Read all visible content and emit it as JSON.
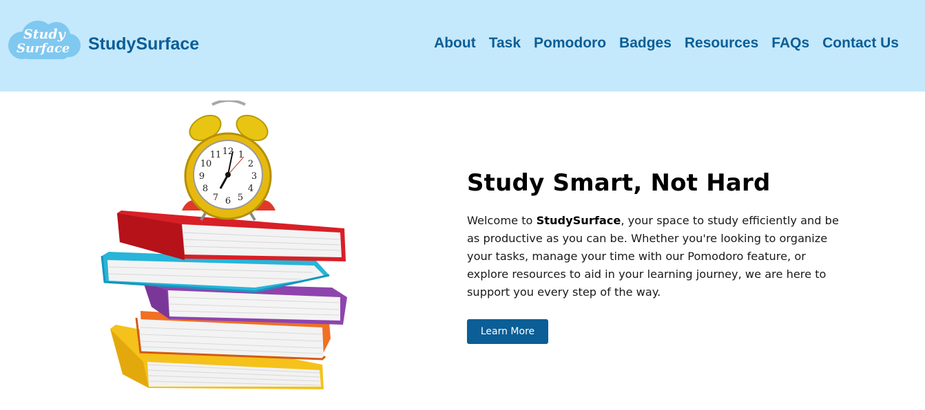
{
  "logo": {
    "line1": "Study",
    "line2": "Surface"
  },
  "header": {
    "brand": "StudySurface"
  },
  "nav": {
    "items": [
      "About",
      "Task",
      "Pomodoro",
      "Badges",
      "Resources",
      "FAQs",
      "Contact Us"
    ]
  },
  "hero": {
    "title": "Study Smart, Not Hard",
    "intro_before": "Welcome to ",
    "intro_brand": "StudySurface",
    "intro_after": ", your space to study efficiently and be as productive as you can be. Whether you're looking to organize your tasks, manage your time with our Pomodoro feature, or explore resources to aid in your learning journey, we are here to support you every step of the way.",
    "button": "Learn More",
    "clock_numbers": [
      "12",
      "1",
      "2",
      "3",
      "4",
      "5",
      "6",
      "7",
      "8",
      "9",
      "10",
      "11"
    ]
  },
  "colors": {
    "header_bg": "#c4e8fc",
    "brand": "#0b5e96",
    "button_bg": "#0b5e96"
  }
}
